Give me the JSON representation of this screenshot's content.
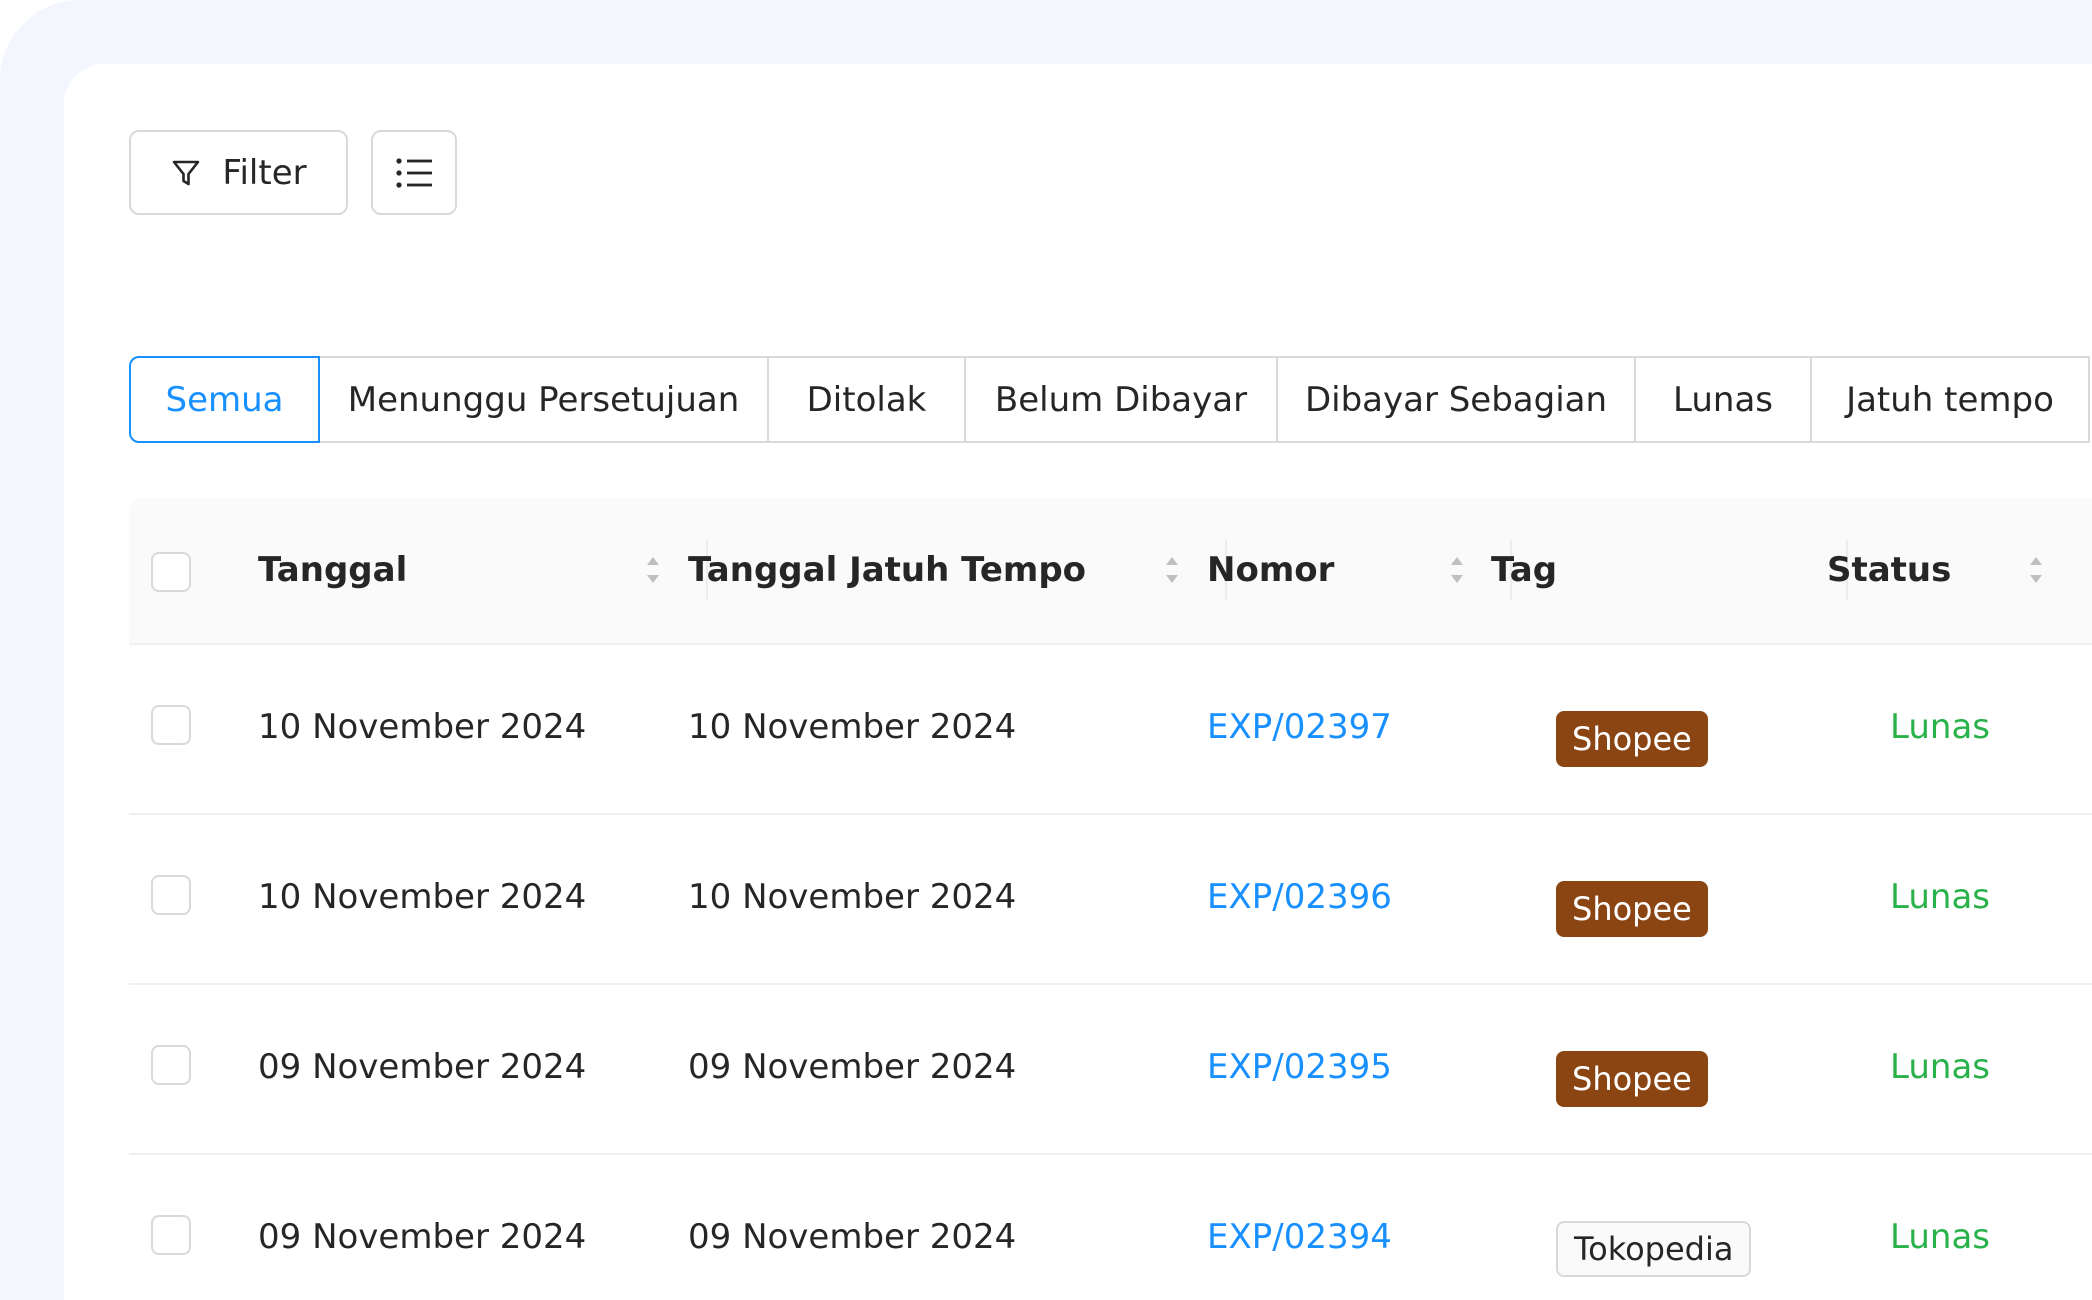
{
  "toolbar": {
    "filter_label": "Filter",
    "list_icon": "list-icon",
    "filter_icon": "funnel-icon"
  },
  "tabs": [
    {
      "label": "Semua",
      "active": true
    },
    {
      "label": "Menunggu Persetujuan",
      "active": false
    },
    {
      "label": "Ditolak",
      "active": false
    },
    {
      "label": "Belum Dibayar",
      "active": false
    },
    {
      "label": "Dibayar Sebagian",
      "active": false
    },
    {
      "label": "Lunas",
      "active": false
    },
    {
      "label": "Jatuh tempo",
      "active": false
    }
  ],
  "table": {
    "columns": [
      {
        "label": "Tanggal",
        "sortable": true
      },
      {
        "label": "Tanggal Jatuh Tempo",
        "sortable": true
      },
      {
        "label": "Nomor",
        "sortable": true
      },
      {
        "label": "Tag",
        "sortable": false
      },
      {
        "label": "Status",
        "sortable": true
      }
    ],
    "rows": [
      {
        "tanggal": "10 November 2024",
        "jatuh_tempo": "10 November 2024",
        "nomor": "EXP/02397",
        "tag": "Shopee",
        "status": "Lunas"
      },
      {
        "tanggal": "10 November 2024",
        "jatuh_tempo": "10 November 2024",
        "nomor": "EXP/02396",
        "tag": "Shopee",
        "status": "Lunas"
      },
      {
        "tanggal": "09 November 2024",
        "jatuh_tempo": "09 November 2024",
        "nomor": "EXP/02395",
        "tag": "Shopee",
        "status": "Lunas"
      },
      {
        "tanggal": "09 November 2024",
        "jatuh_tempo": "09 November 2024",
        "nomor": "EXP/02394",
        "tag": "Tokopedia",
        "status": "Lunas"
      }
    ]
  },
  "colors": {
    "accent": "#1890ff",
    "status_paid": "#29b24a",
    "shopee_tag": "#8b4513",
    "background": "#f3f6fc"
  }
}
